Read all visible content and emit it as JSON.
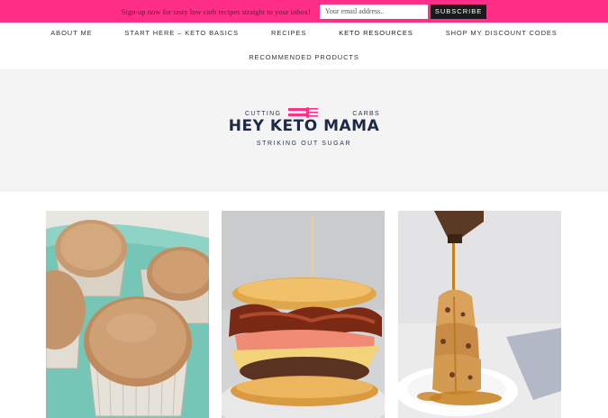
{
  "topbar": {
    "promo_text": "Sign-up now for tasty low carb recipes straight to your inbox!",
    "email_placeholder": "Your email address..",
    "subscribe_label": "SUBSCRIBE",
    "bg_color": "#ff2e86"
  },
  "nav": {
    "row1": [
      "ABOUT ME",
      "START HERE – KETO BASICS",
      "RECIPES",
      "KETO RESOURCES",
      "SHOP MY DISCOUNT CODES"
    ],
    "row2": [
      "RECOMMENDED PRODUCTS"
    ]
  },
  "logo": {
    "left_word": "CUTTING",
    "right_word": "CARBS",
    "brand": "HEY KETO MAMA",
    "tagline": "STRIKING OUT SUGAR",
    "icon": "fork-icon"
  },
  "posts": [
    {
      "image": "cupcakes-photo"
    },
    {
      "image": "bacon-burger-photo"
    },
    {
      "image": "syrup-muffin-stack-photo"
    }
  ]
}
